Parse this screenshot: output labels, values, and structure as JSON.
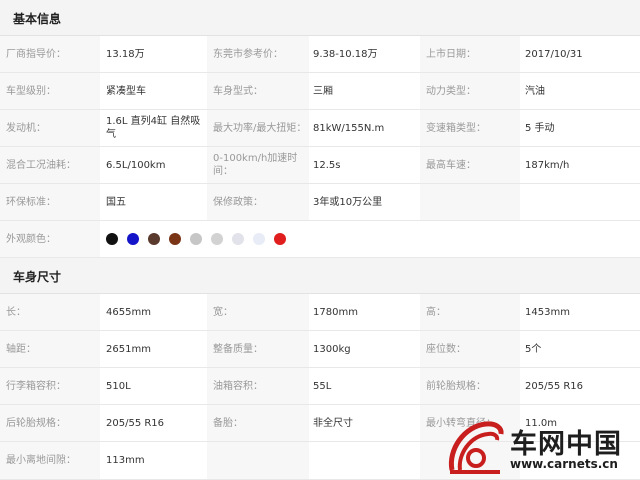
{
  "basic": {
    "title": "基本信息",
    "rows": [
      [
        "厂商指导价：",
        "13.18万",
        "东莞市参考价：",
        "9.38-10.18万",
        "上市日期：",
        "2017/10/31"
      ],
      [
        "车型级别：",
        "紧凑型车",
        "车身型式：",
        "三厢",
        "动力类型：",
        "汽油"
      ],
      [
        "发动机：",
        "1.6L 直列4缸 自然吸气",
        "最大功率/最大扭矩：",
        "81kW/155N.m",
        "变速箱类型：",
        "5 手动"
      ],
      [
        "混合工况油耗：",
        "6.5L/100km",
        "0-100km/h加速时间：",
        "12.5s",
        "最高车速：",
        "187km/h"
      ],
      [
        "环保标准：",
        "国五",
        "保修政策：",
        "3年或10万公里",
        "",
        ""
      ]
    ],
    "color_label": "外观颜色：",
    "colors": [
      "#111111",
      "#1414c8",
      "#5a3a2c",
      "#7a3416",
      "#c6c6c6",
      "#d2d2d2",
      "#e2e2ea",
      "#e8ecf6",
      "#e01e1e"
    ]
  },
  "body": {
    "title": "车身尺寸",
    "rows": [
      [
        "长：",
        "4655mm",
        "宽：",
        "1780mm",
        "高：",
        "1453mm"
      ],
      [
        "轴距：",
        "2651mm",
        "整备质量：",
        "1300kg",
        "座位数：",
        "5个"
      ],
      [
        "行李箱容积：",
        "510L",
        "油箱容积：",
        "55L",
        "前轮胎规格：",
        "205/55 R16"
      ],
      [
        "后轮胎规格：",
        "205/55 R16",
        "备胎：",
        "非全尺寸",
        "最小转弯直径：",
        "11.0m"
      ],
      [
        "最小离地间隙：",
        "113mm",
        "",
        "",
        "",
        ""
      ]
    ]
  },
  "watermark": {
    "name": "车网中国",
    "url": "www.carnets.cn",
    "logo_color": "#c81e1e"
  }
}
